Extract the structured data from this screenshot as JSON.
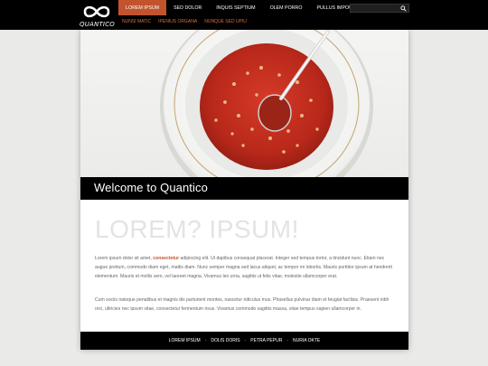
{
  "brand": {
    "name": "QUANTICO"
  },
  "nav": {
    "items": [
      {
        "label": "LOREM IPSUM",
        "active": true
      },
      {
        "label": "SED DOLOR",
        "active": false
      },
      {
        "label": "INQUIS SEPTIUM",
        "active": false
      },
      {
        "label": "OLEM PORRO",
        "active": false
      },
      {
        "label": "PULLUS IMPOUS",
        "active": false
      }
    ],
    "subitems": [
      "NUNSI MATIC",
      "IPENIUS ORGANA",
      "NUNQUE SED UPIU"
    ]
  },
  "search": {
    "placeholder": "",
    "icon": "search-icon"
  },
  "welcome": {
    "title": "Welcome to Quantico"
  },
  "main": {
    "headline": "LOREM? IPSUM!",
    "para1_before": "Lorem ipsum dolor sit amet, ",
    "para1_highlight": "consectetur",
    "para1_after": " adipiscing elit. Ut dapibus consequat placerat. Integer sed tempus tortor, a tincidunt nunc. Etiam nec augue pretium, commodo diam eget, mattis diam. Nunc semper magna sed lacus aliquet, ac tempor mi lobortis. Mauris porttitor ipsum at hendrerit elementum. Mauris et mollis sem, vel laoreet magna. Vivamus leo urna, sagittis ut felis vitae, molestie ullamcorper erat.",
    "para2": "Cum sociis natoque penatibus et magnis dis parturient montes, nascetur ridiculus mus. Phasellus pulvinar diam et feugiat facilisis. Praesent nibh orci, ultricies nec ipsum vitae, consectetur fermentum risus. Vivamus commodo sagittis massa, vitae tempus sapien ullamcorper in."
  },
  "footer": {
    "links": [
      "LOREM IPSUM",
      "DOLIS DORIS",
      "PETRA PEPUR",
      "NURIA OKTE"
    ]
  },
  "colors": {
    "accent": "#c2542d",
    "background": "#eaeae8",
    "bar": "#000000"
  }
}
